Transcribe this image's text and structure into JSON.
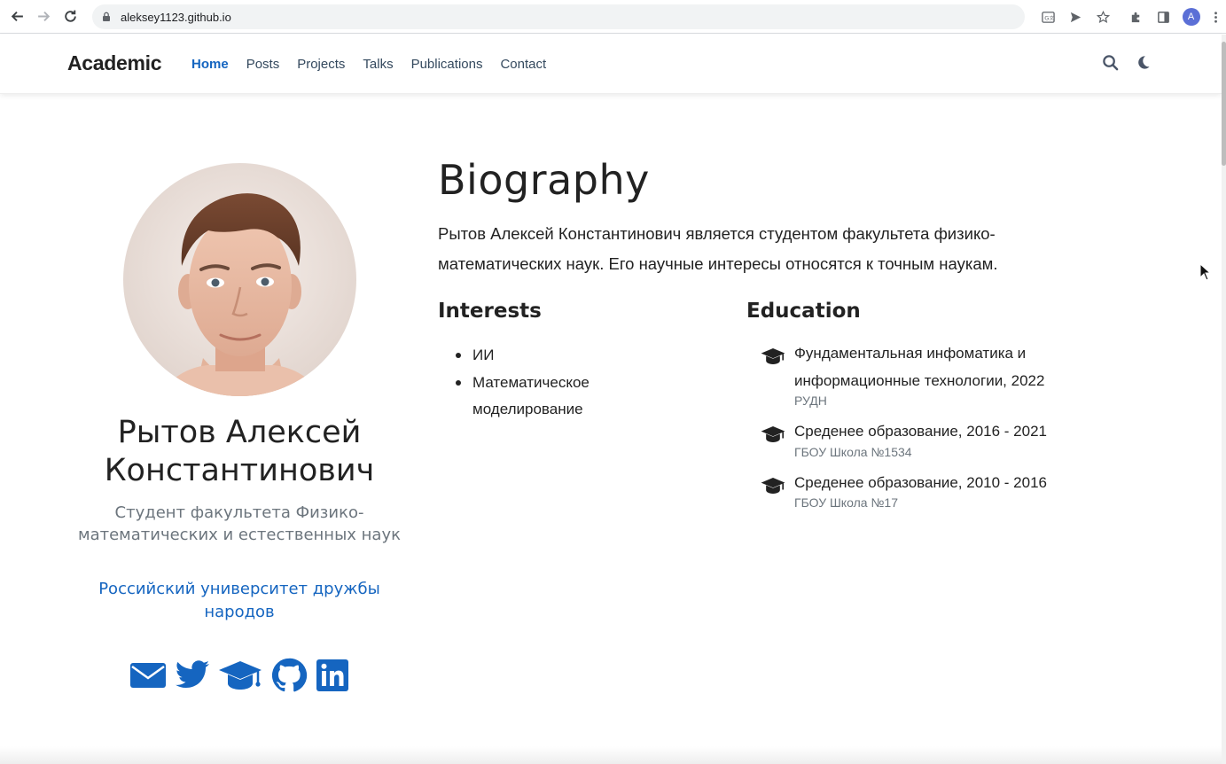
{
  "browser": {
    "url": "aleksey1123.github.io",
    "profile_initial": "A"
  },
  "site": {
    "brand": "Academic",
    "menu": [
      {
        "label": "Home",
        "active": true
      },
      {
        "label": "Posts"
      },
      {
        "label": "Projects"
      },
      {
        "label": "Talks"
      },
      {
        "label": "Publications"
      },
      {
        "label": "Contact"
      }
    ]
  },
  "profile": {
    "name": "Рытов Алексей Константинович",
    "role": "Студент факультета Физико-математических и естественных наук",
    "organization": "Российский университет дружбы народов",
    "social_icons": [
      "envelope-icon",
      "twitter-icon",
      "graduation-cap-icon",
      "github-icon",
      "linkedin-icon"
    ]
  },
  "biography": {
    "title": "Biography",
    "text": "Рытов Алексей Константинович является студентом факультета физико-математических наук. Его научные интересы относятся к точным наукам."
  },
  "interests": {
    "title": "Interests",
    "items": [
      "ИИ",
      "Математическое моделирование"
    ]
  },
  "education": {
    "title": "Education",
    "items": [
      {
        "course": "Фундаментальная инфоматика и информационные технологии, 2022",
        "institution": "РУДН"
      },
      {
        "course": "Среденее образование, 2016 - 2021",
        "institution": "ГБОУ Школа №1534"
      },
      {
        "course": "Среденее образование, 2010 - 2016",
        "institution": "ГБОУ Школа №17"
      }
    ]
  },
  "colors": {
    "accent": "#1565c0",
    "text": "#222222",
    "muted": "#6c757d"
  }
}
